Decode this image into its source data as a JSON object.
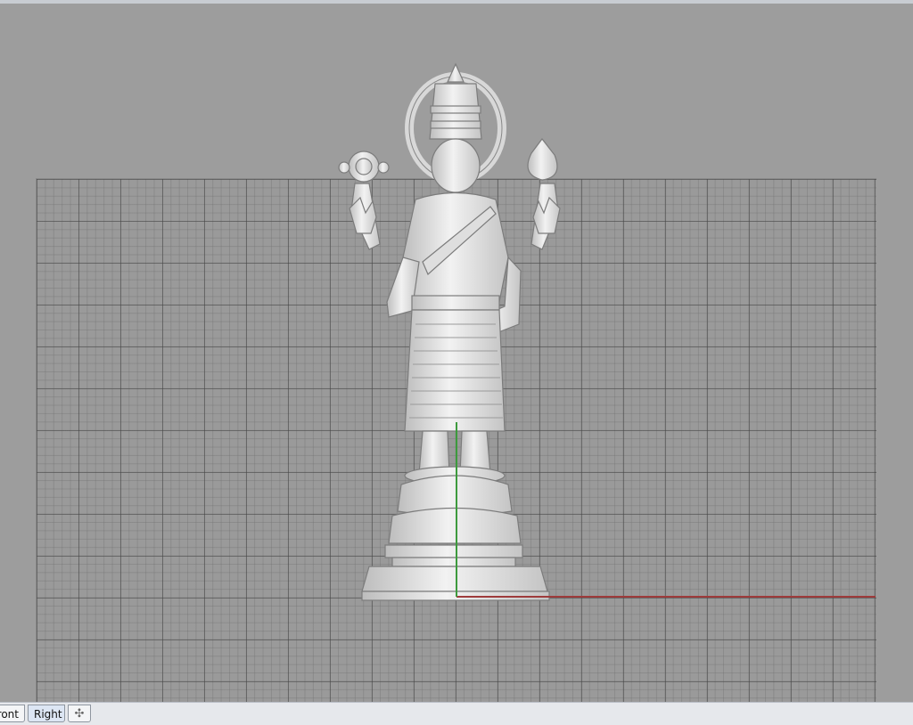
{
  "viewport": {
    "tabs": [
      {
        "label": "ront"
      },
      {
        "label": "Right"
      }
    ],
    "add_tab_icon": "plus-icon"
  },
  "colors": {
    "background": "#9d9d9d",
    "grid_major": "#464646",
    "x_axis": "#9e3b3b",
    "y_axis": "#3d9a3d",
    "model": "#e9e9e9"
  }
}
